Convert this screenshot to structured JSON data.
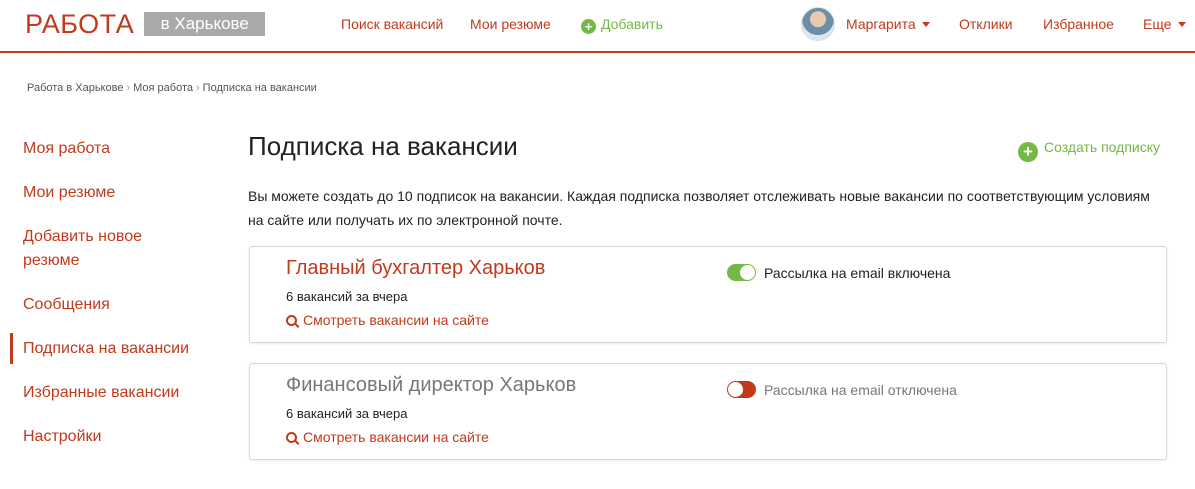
{
  "header": {
    "logo": "РАБОТА",
    "city": "в Харькове",
    "nav": {
      "search": "Поиск вакансий",
      "resumes": "Мои резюме",
      "add": "Добавить",
      "user": "Маргарита",
      "responses": "Отклики",
      "favorites": "Избранное",
      "more": "Еще"
    }
  },
  "breadcrumb": {
    "items": [
      "Работа в Харькове",
      "Моя работа",
      "Подписка на вакансии"
    ],
    "separator": "›"
  },
  "sidebar": {
    "items": [
      {
        "label": "Моя работа"
      },
      {
        "label": "Мои резюме"
      },
      {
        "label": "Добавить новое резюме"
      },
      {
        "label": "Сообщения"
      },
      {
        "label": "Подписка на вакансии",
        "active": true
      },
      {
        "label": "Избранные вакансии"
      },
      {
        "label": "Настройки"
      }
    ]
  },
  "main": {
    "title": "Подписка на вакансии",
    "create_label": "Создать подписку",
    "description": "Вы можете создать до 10 подписок на вакансии. Каждая подписка позволяет отслеживать новые вакансии по соответствующим условиям на сайте или получать их по электронной почте.",
    "subscriptions": [
      {
        "title": "Главный бухгалтер Харьков",
        "count": "6 вакансий за вчера",
        "link": "Смотреть вакансии на сайте",
        "email_enabled": true,
        "status": "Рассылка на email включена"
      },
      {
        "title": "Финансовый директор Харьков",
        "count": "6 вакансий за вчера",
        "link": "Смотреть вакансии на сайте",
        "email_enabled": false,
        "status": "Рассылка на email отключена"
      }
    ]
  },
  "colors": {
    "accent": "#c23a1c",
    "green": "#74b845",
    "muted": "#777777",
    "city_bg": "#a9a9a9"
  }
}
